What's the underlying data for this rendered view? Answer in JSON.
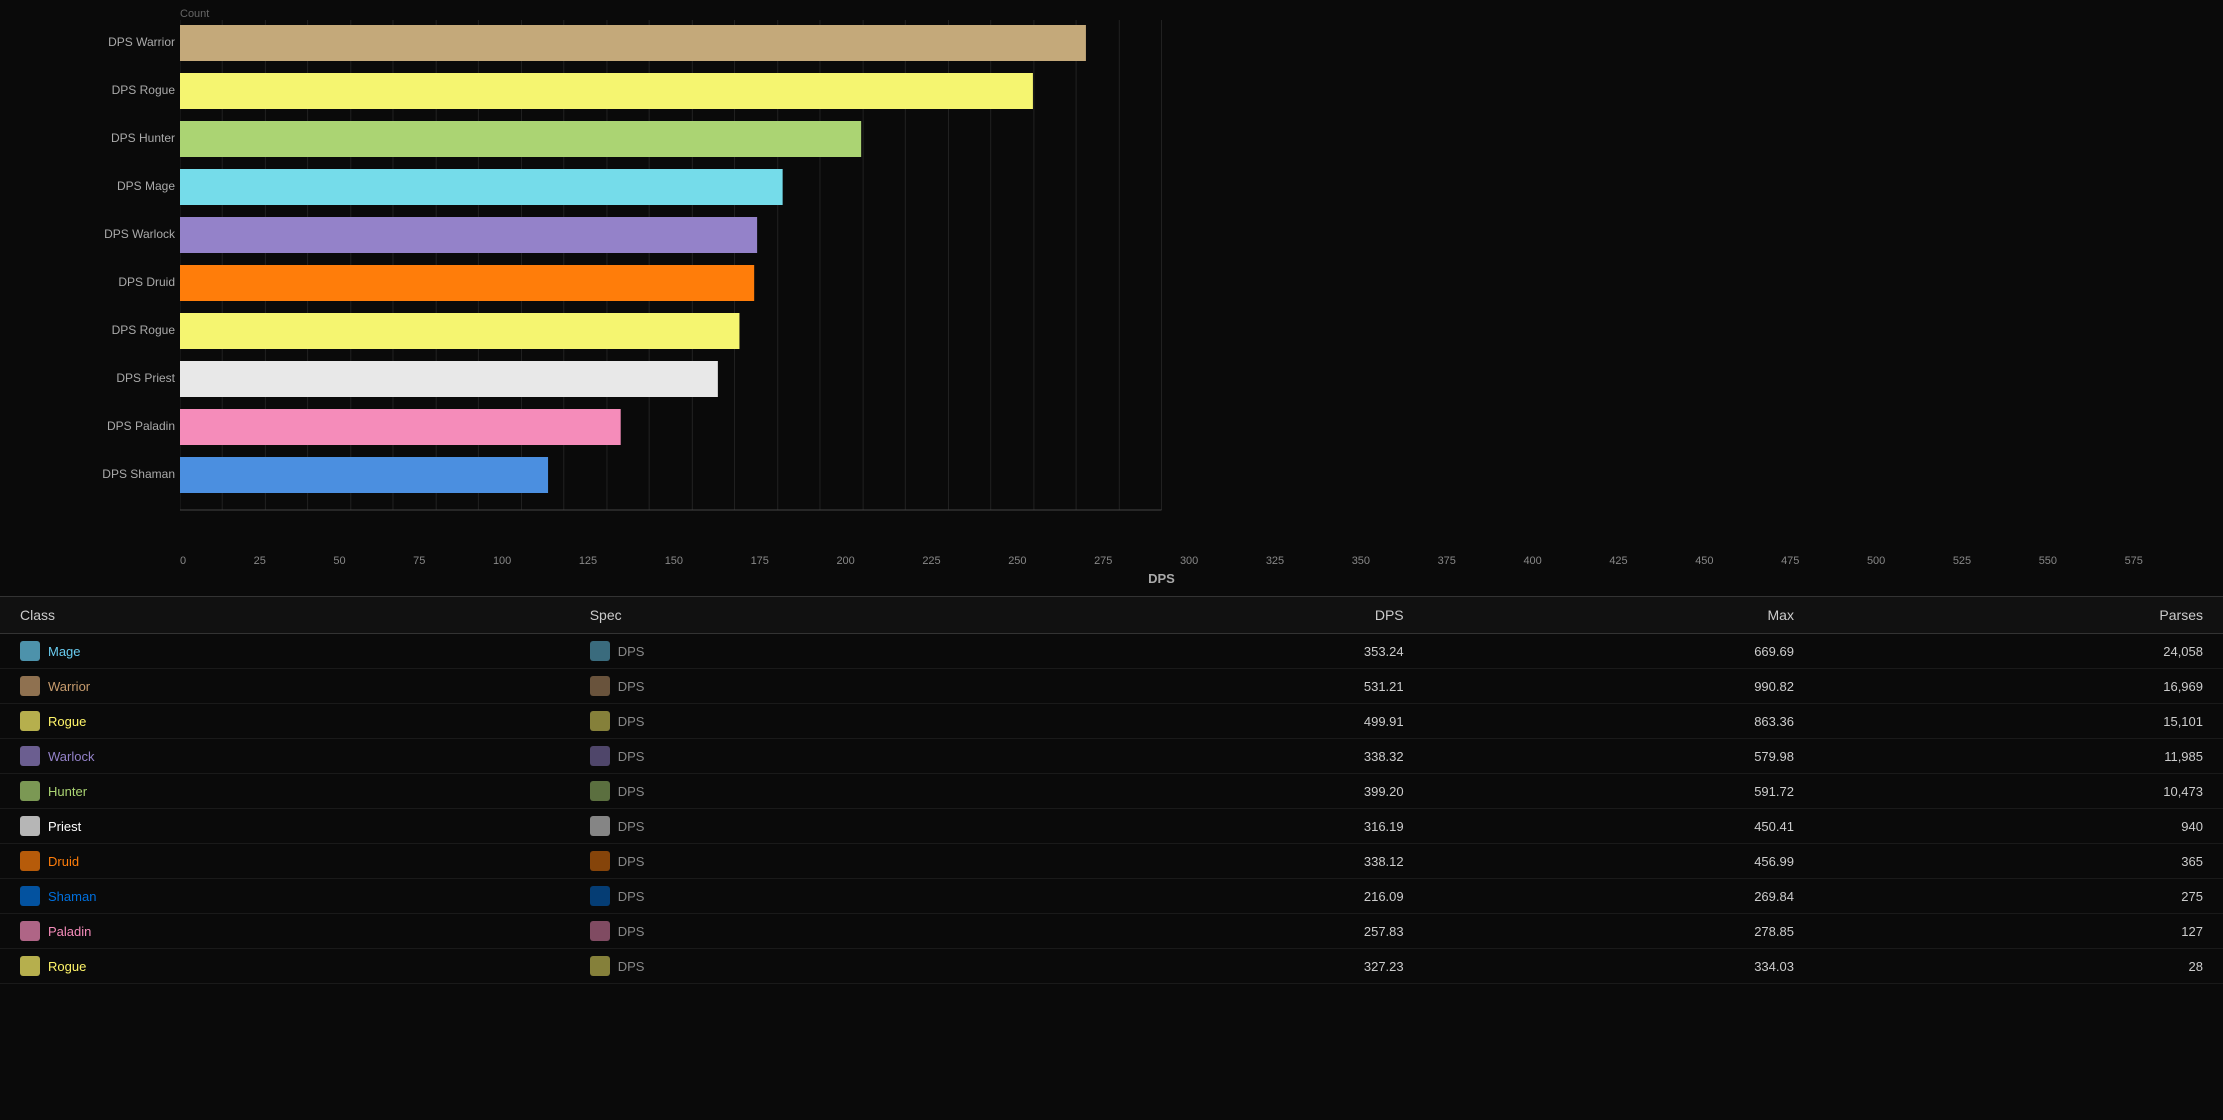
{
  "chart": {
    "title": "Count",
    "x_axis_label": "DPS",
    "x_ticks": [
      0,
      25,
      50,
      75,
      100,
      125,
      150,
      175,
      200,
      225,
      250,
      275,
      300,
      325,
      350,
      375,
      400,
      425,
      450,
      475,
      500,
      525,
      550,
      575
    ],
    "max_value": 575,
    "bars": [
      {
        "label": "DPS Warrior",
        "value": 531,
        "color": "#C4A97A"
      },
      {
        "label": "DPS Rogue",
        "value": 500,
        "color": "#F5F570"
      },
      {
        "label": "DPS Hunter",
        "value": 399,
        "color": "#ABD473"
      },
      {
        "label": "DPS Mage",
        "value": 353,
        "color": "#75DCEA"
      },
      {
        "label": "DPS Warlock",
        "value": 338,
        "color": "#9482C9"
      },
      {
        "label": "DPS Druid",
        "value": 338,
        "color": "#FF7D0A"
      },
      {
        "label": "DPS Rogue",
        "value": 328,
        "color": "#F5F570"
      },
      {
        "label": "DPS Priest",
        "value": 316,
        "color": "#E8E8E8"
      },
      {
        "label": "DPS Paladin",
        "value": 258,
        "color": "#F58CBA"
      },
      {
        "label": "DPS Shaman",
        "value": 216,
        "color": "#4B8FE0"
      }
    ]
  },
  "table": {
    "headers": [
      "Class",
      "Spec",
      "DPS",
      "Max",
      "Parses"
    ],
    "rows": [
      {
        "class": "Mage",
        "class_color": "class-name-mage",
        "spec": "DPS",
        "dps": "353.24",
        "max": "669.69",
        "parses": "24,058",
        "icon_color": "#69CCF0"
      },
      {
        "class": "Warrior",
        "class_color": "class-name-warrior",
        "spec": "DPS",
        "dps": "531.21",
        "max": "990.82",
        "parses": "16,969",
        "icon_color": "#C79C6E"
      },
      {
        "class": "Rogue",
        "class_color": "class-name-rogue",
        "spec": "DPS",
        "dps": "499.91",
        "max": "863.36",
        "parses": "15,101",
        "icon_color": "#FFF569"
      },
      {
        "class": "Warlock",
        "class_color": "class-name-warlock",
        "spec": "DPS",
        "dps": "338.32",
        "max": "579.98",
        "parses": "11,985",
        "icon_color": "#9482C9"
      },
      {
        "class": "Hunter",
        "class_color": "class-name-hunter",
        "spec": "DPS",
        "dps": "399.20",
        "max": "591.72",
        "parses": "10,473",
        "icon_color": "#ABD473"
      },
      {
        "class": "Priest",
        "class_color": "class-name-priest",
        "spec": "DPS",
        "dps": "316.19",
        "max": "450.41",
        "parses": "940",
        "icon_color": "#FFFFFF"
      },
      {
        "class": "Druid",
        "class_color": "class-name-druid",
        "spec": "DPS",
        "dps": "338.12",
        "max": "456.99",
        "parses": "365",
        "icon_color": "#FF7D0A"
      },
      {
        "class": "Shaman",
        "class_color": "class-name-shaman",
        "spec": "DPS",
        "dps": "216.09",
        "max": "269.84",
        "parses": "275",
        "icon_color": "#0070DE"
      },
      {
        "class": "Paladin",
        "class_color": "class-name-paladin",
        "spec": "DPS",
        "dps": "257.83",
        "max": "278.85",
        "parses": "127",
        "icon_color": "#F58CBA"
      },
      {
        "class": "Rogue",
        "class_color": "class-name-rogue",
        "spec": "DPS",
        "dps": "327.23",
        "max": "334.03",
        "parses": "28",
        "icon_color": "#FFF569"
      }
    ]
  }
}
